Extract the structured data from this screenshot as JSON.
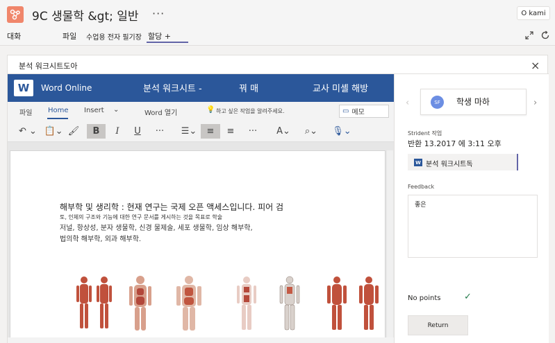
{
  "header": {
    "channel_title": "9C 생물학 &gt;  일반",
    "more": "···",
    "user": "O kami"
  },
  "tabs": {
    "items": [
      {
        "label": "대화"
      },
      {
        "label": "파일"
      },
      {
        "label": "수업용 전자 필기장"
      },
      {
        "label": "할당 +"
      }
    ],
    "active_index": 3
  },
  "panel": {
    "title": "분석 워크시트도아",
    "close": "×"
  },
  "word": {
    "app_name": "Word Online",
    "doc_title": "분석 워크시트 -",
    "doc_sep": "꿔 매",
    "sharing": "교사 미셸 해방",
    "ribbon_tabs": [
      "파일",
      "Home",
      "Insert",
      "Word 열기",
      "하고 싶은 작업을 알려주세요."
    ],
    "comments": "메모",
    "text": {
      "line1": "해부학 및 생리학 : 현재 연구는 국제 오픈 액세스입니다. 피어 검",
      "line2": "토, 인체의 구조와 기능에 대한 연구 문서를 게시하는 것을 목표로 학술",
      "line3": "저널, 항상성, 분자 생물학, 신경 물제술, 세포 생물학, 임상 해부학,",
      "line4": "법의학 해부학, 외과 해부학."
    }
  },
  "side": {
    "student_initials": "SF",
    "student_name": "학생 마하",
    "work_label": "Strident 작업",
    "returned": "반환 13.2017 에 3:11 오후",
    "file_name": "분석 워크시트독",
    "feedback_label": "Feedback",
    "feedback_text": "좋은",
    "points": "No points",
    "return_label": "Return"
  },
  "colors": {
    "word_blue": "#2b579a",
    "teams_purple": "#6264a7",
    "team_avatar": "#f0866b",
    "check_green": "#237b4b"
  }
}
